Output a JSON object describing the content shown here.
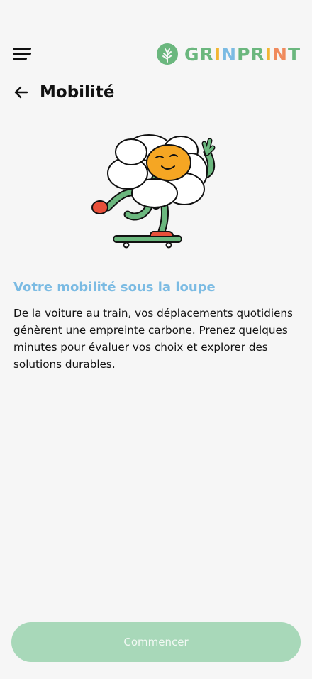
{
  "header": {
    "menu_icon": "hamburger-menu-icon",
    "logo": {
      "icon": "tree-logo-icon",
      "letters": [
        {
          "char": "G",
          "color": "#6bb77e"
        },
        {
          "char": "R",
          "color": "#6bb77e"
        },
        {
          "char": "I",
          "color": "#f2b632"
        },
        {
          "char": "N",
          "color": "#7bbbe3"
        },
        {
          "char": "P",
          "color": "#6bb77e"
        },
        {
          "char": "R",
          "color": "#6bb77e"
        },
        {
          "char": "I",
          "color": "#f2b632"
        },
        {
          "char": "N",
          "color": "#f08a5d"
        },
        {
          "char": "T",
          "color": "#6bb77e"
        }
      ]
    }
  },
  "page": {
    "back_icon": "arrow-left-icon",
    "title": "Mobilité"
  },
  "illustration": {
    "icon": "daisy-skateboard-illustration"
  },
  "content": {
    "section_title": "Votre mobilité sous la loupe",
    "description": "De la voiture au train, vos déplacements quotidiens génèrent une empreinte carbone. Prenez quelques minutes pour évaluer vos choix et explorer des solutions durables."
  },
  "actions": {
    "start_label": "Commencer"
  },
  "colors": {
    "background": "#f6f6f6",
    "accent_blue": "#7bbbe3",
    "accent_green": "#6bb77e",
    "button_disabled": "#a8d8b9",
    "petal": "#ffffff",
    "flower_center": "#f5a623",
    "shoe": "#e8503a"
  }
}
